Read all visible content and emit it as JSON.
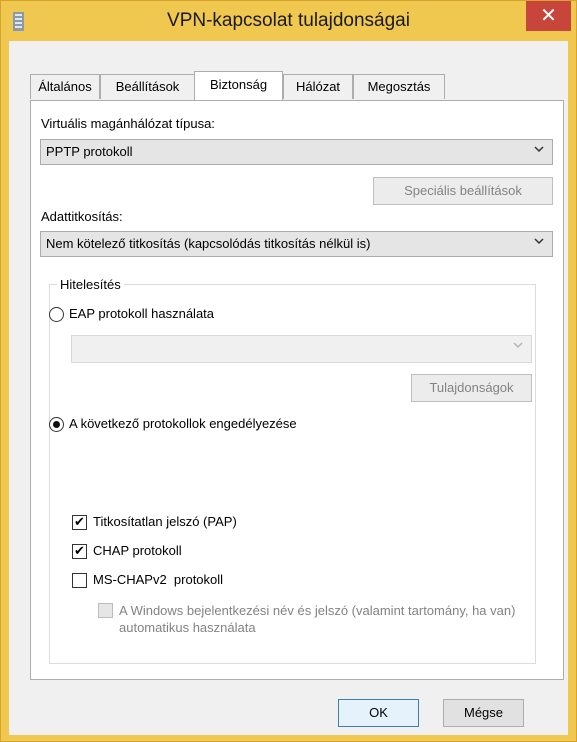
{
  "window": {
    "title": "VPN-kapcsolat tulajdonságai",
    "close_glyph": "✕",
    "accent_color": "#f0c850",
    "close_color": "#c7453b"
  },
  "tabs": [
    {
      "label": "Általános",
      "active": false
    },
    {
      "label": "Beállítások",
      "active": false
    },
    {
      "label": "Biztonság",
      "active": true
    },
    {
      "label": "Hálózat",
      "active": false
    },
    {
      "label": "Megosztás",
      "active": false
    }
  ],
  "vpn_type": {
    "label": "Virtuális magánhálózat típusa:",
    "value": "PPTP protokoll"
  },
  "advanced_button": "Speciális beállítások",
  "encryption": {
    "label": "Adattitkosítás:",
    "value": "Nem kötelező titkosítás (kapcsolódás titkosítás nélkül is)"
  },
  "auth": {
    "title": "Hitelesítés",
    "eap_label": "EAP protokoll használata",
    "eap_selected": false,
    "eap_value": "",
    "properties_button": "Tulajdonságok",
    "allow_label": "A következő protokollok engedélyezése",
    "allow_selected": true,
    "pap": {
      "label": "Titkosítatlan jelszó (PAP)",
      "checked": true
    },
    "chap": {
      "label": "CHAP protokoll",
      "checked": true
    },
    "mschap": {
      "label": "MS-CHAPv2  protokoll",
      "checked": false
    },
    "windows_logon": {
      "label": "A Windows bejelentkezési név és jelszó (valamint tartomány, ha van) automatikus használata",
      "checked": false
    }
  },
  "footer": {
    "ok": "OK",
    "cancel": "Mégse"
  },
  "check_glyph": "✔"
}
